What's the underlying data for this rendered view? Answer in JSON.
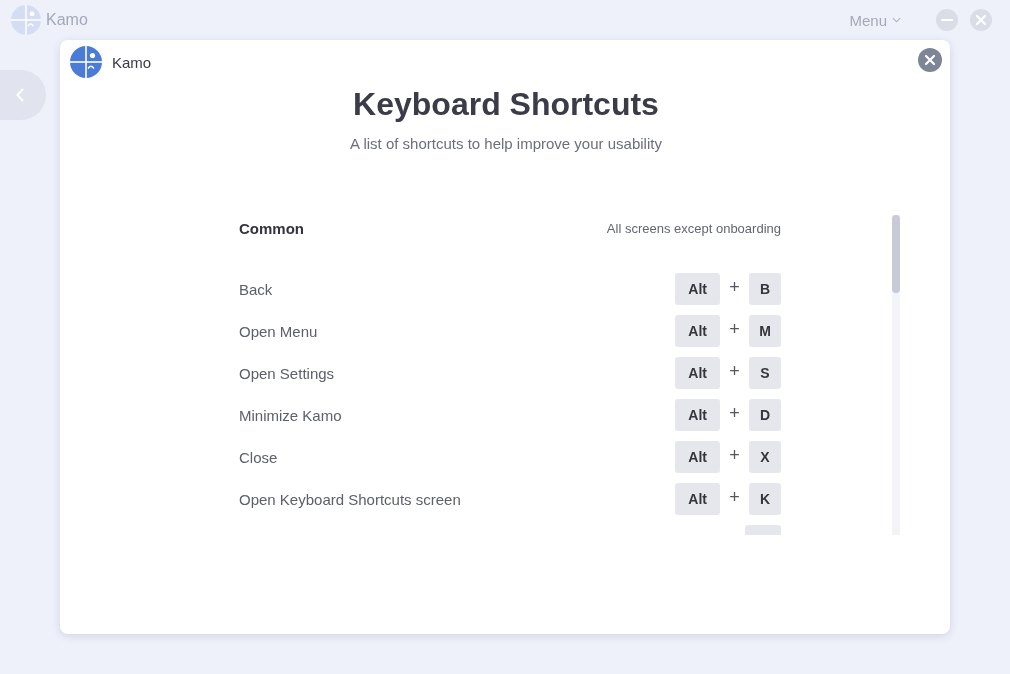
{
  "window": {
    "title": "Kamo",
    "menu": "Menu"
  },
  "dialog": {
    "brand": "Kamo",
    "title": "Keyboard Shortcuts",
    "subtitle": "A list of shortcuts to help improve your usability",
    "section": {
      "title": "Common",
      "scope": "All screens except onboarding"
    },
    "shortcuts": [
      {
        "label": "Back",
        "keys": [
          {
            "kind": "key",
            "text": "Alt"
          },
          {
            "kind": "plus",
            "text": "+"
          },
          {
            "kind": "key",
            "text": "B"
          }
        ]
      },
      {
        "label": "Open Menu",
        "keys": [
          {
            "kind": "key",
            "text": "Alt"
          },
          {
            "kind": "plus",
            "text": "+"
          },
          {
            "kind": "key",
            "text": "M"
          }
        ]
      },
      {
        "label": "Open Settings",
        "keys": [
          {
            "kind": "key",
            "text": "Alt"
          },
          {
            "kind": "plus",
            "text": "+"
          },
          {
            "kind": "key",
            "text": "S"
          }
        ]
      },
      {
        "label": "Minimize Kamo",
        "keys": [
          {
            "kind": "key",
            "text": "Alt"
          },
          {
            "kind": "plus",
            "text": "+"
          },
          {
            "kind": "key",
            "text": "D"
          }
        ]
      },
      {
        "label": "Close",
        "keys": [
          {
            "kind": "key",
            "text": "Alt"
          },
          {
            "kind": "plus",
            "text": "+"
          },
          {
            "kind": "key",
            "text": "X"
          }
        ]
      },
      {
        "label": "Open Keyboard Shortcuts screen",
        "keys": [
          {
            "kind": "key",
            "text": "Alt"
          },
          {
            "kind": "plus",
            "text": "+"
          },
          {
            "kind": "key",
            "text": "K"
          }
        ]
      }
    ],
    "more_below": true
  }
}
